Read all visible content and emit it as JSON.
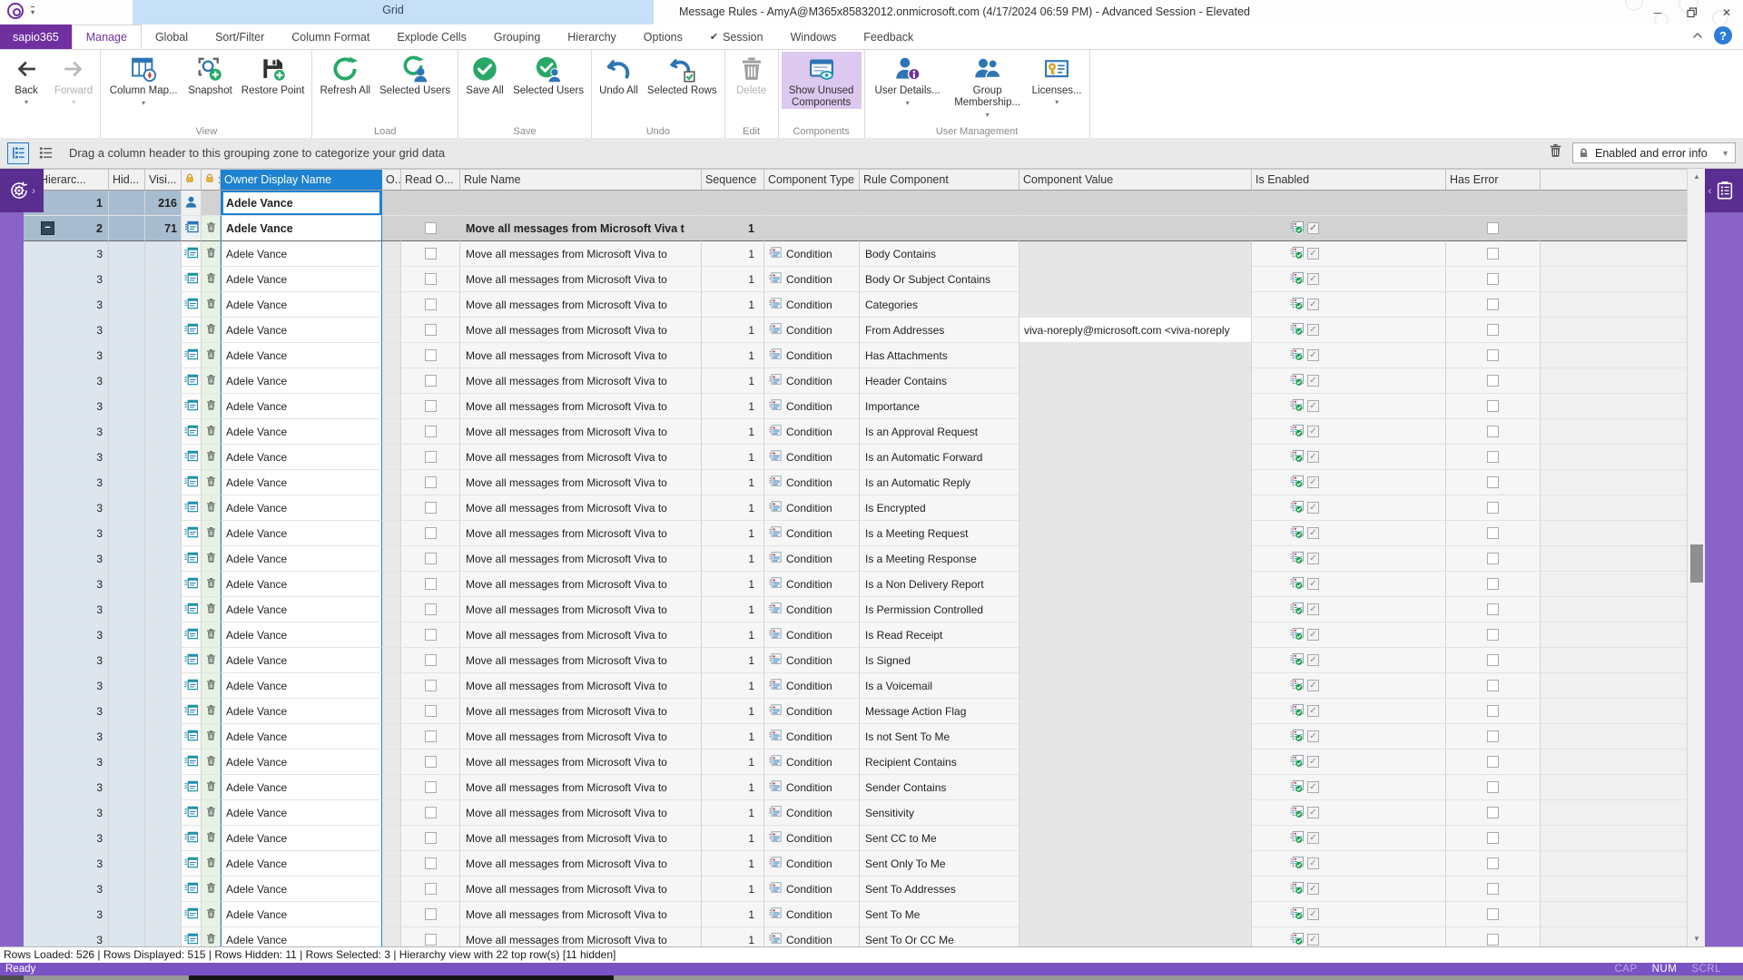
{
  "colors": {
    "accent_purple": "#7030a0",
    "statusbar_purple": "#7a52c4",
    "selection_blue": "#1e82d2",
    "context_tab_blue": "#c6e1f7",
    "enabled_green": "#27a867"
  },
  "window": {
    "app": "sapio365",
    "context_tab": "Grid",
    "title": "Message Rules - AmyA@M365x85832012.onmicrosoft.com (4/17/2024 06:59 PM) - Advanced Session - Elevated"
  },
  "tabs": [
    {
      "label": "sapio365",
      "type": "app"
    },
    {
      "label": "Manage",
      "active": true
    },
    {
      "label": "Global"
    },
    {
      "label": "Sort/Filter"
    },
    {
      "label": "Column Format"
    },
    {
      "label": "Explode Cells"
    },
    {
      "label": "Grouping"
    },
    {
      "label": "Hierarchy"
    },
    {
      "label": "Options"
    },
    {
      "label": "Session",
      "checked": true
    },
    {
      "label": "Windows"
    },
    {
      "label": "Feedback"
    }
  ],
  "ribbon": {
    "groups": [
      {
        "name": "",
        "buttons": [
          {
            "label": "Back",
            "icon": "back",
            "caret": "below"
          },
          {
            "label": "Forward",
            "icon": "forward",
            "caret": "below",
            "disabled": true
          }
        ]
      },
      {
        "name": "View",
        "buttons": [
          {
            "label": "Column Map...",
            "icon": "column-map",
            "caret": "inline"
          },
          {
            "label": "Snapshot",
            "icon": "snapshot"
          },
          {
            "label": "Restore Point",
            "icon": "restore-point"
          }
        ]
      },
      {
        "name": "Load",
        "buttons": [
          {
            "label": "Refresh All",
            "icon": "refresh"
          },
          {
            "label": "Selected Users",
            "icon": "refresh-user"
          }
        ]
      },
      {
        "name": "Save",
        "buttons": [
          {
            "label": "Save All",
            "icon": "save"
          },
          {
            "label": "Selected Users",
            "icon": "save-user"
          }
        ]
      },
      {
        "name": "Undo",
        "buttons": [
          {
            "label": "Undo All",
            "icon": "undo"
          },
          {
            "label": "Selected Rows",
            "icon": "undo-rows"
          }
        ]
      },
      {
        "name": "Edit",
        "buttons": [
          {
            "label": "Delete",
            "icon": "delete",
            "disabled": true
          }
        ]
      },
      {
        "name": "Components",
        "buttons": [
          {
            "label": "Show Unused Components",
            "icon": "show-unused",
            "toggled": true
          }
        ]
      },
      {
        "name": "User Management",
        "buttons": [
          {
            "label": "User Details...",
            "icon": "user-details",
            "caret": "inline"
          },
          {
            "label": "Group Membership...",
            "icon": "group-membership",
            "caret": "inline"
          },
          {
            "label": "Licenses...",
            "icon": "licenses",
            "caret": "below"
          }
        ]
      }
    ]
  },
  "grouping_bar": {
    "hint": "Drag a column header to this grouping zone to categorize your grid data",
    "filter": {
      "label": "Enabled and error info"
    }
  },
  "grid": {
    "columns": [
      {
        "key": "hier",
        "label": "Hierarc...",
        "lock": true
      },
      {
        "key": "hid",
        "label": "Hid..."
      },
      {
        "key": "visi",
        "label": "Visi..."
      },
      {
        "key": "icon",
        "label": "",
        "lock": true
      },
      {
        "key": "trash",
        "label": ":",
        "lock": true
      },
      {
        "key": "owner",
        "label": "Owner Display Name",
        "selected": true
      },
      {
        "key": "o",
        "label": "O..."
      },
      {
        "key": "reado",
        "label": "Read O..."
      },
      {
        "key": "rulename",
        "label": "Rule Name"
      },
      {
        "key": "sequence",
        "label": "Sequence"
      },
      {
        "key": "comptype",
        "label": "Component Type"
      },
      {
        "key": "rulecomp",
        "label": "Rule Component"
      },
      {
        "key": "compvalue",
        "label": "Component Value"
      },
      {
        "key": "isenabled",
        "label": "Is Enabled"
      },
      {
        "key": "haserror",
        "label": "Has Error"
      }
    ],
    "group_rows": [
      {
        "level": 1,
        "hierarchy": "1",
        "visible": "216",
        "icon": "user",
        "owner": "Adele Vance",
        "selected": true,
        "bold": true,
        "expanded": true
      },
      {
        "level": 2,
        "hierarchy": "2",
        "visible": "71",
        "icon": "rule",
        "owner": "Adele Vance",
        "selected": true,
        "bold": true,
        "expanded": true,
        "rule_name": "Move all messages from Microsoft Viva t",
        "sequence": "1",
        "is_enabled": true
      }
    ],
    "details": {
      "hierarchy": "3",
      "owner": "Adele Vance",
      "rule_name": "Move all messages from Microsoft Viva to",
      "sequence": "1",
      "component_type": "Condition",
      "rule_components": [
        "Body Contains",
        "Body Or Subject Contains",
        "Categories",
        "From Addresses",
        "Has Attachments",
        "Header Contains",
        "Importance",
        "Is an Approval Request",
        "Is an Automatic Forward",
        "Is an Automatic Reply",
        "Is Encrypted",
        "Is a Meeting Request",
        "Is a Meeting Response",
        "Is a Non Delivery Report",
        "Is Permission Controlled",
        "Is Read Receipt",
        "Is Signed",
        "Is a Voicemail",
        "Message Action Flag",
        "Is not Sent To Me",
        "Recipient Contains",
        "Sender Contains",
        "Sensitivity",
        "Sent CC to Me",
        "Sent Only To Me",
        "Sent To Addresses",
        "Sent To Me",
        "Sent To Or CC Me"
      ],
      "component_values": {
        "From Addresses": "viva-noreply@microsoft.com <viva-noreply"
      }
    }
  },
  "status": {
    "info": "Rows Loaded: 526 | Rows Displayed: 515 | Rows Hidden: 11 | Rows Selected: 3 | Hierarchy view with 22 top row(s) [11 hidden]",
    "ready": "Ready",
    "indicators": [
      {
        "label": "CAP",
        "active": false
      },
      {
        "label": "NUM",
        "active": true
      },
      {
        "label": "SCRL",
        "active": false
      }
    ]
  }
}
